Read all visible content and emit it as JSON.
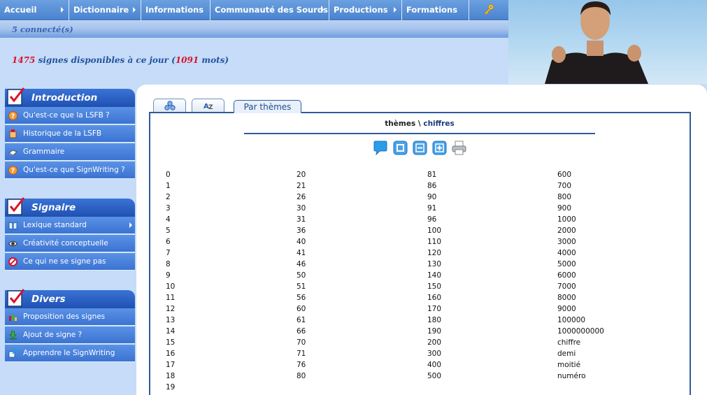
{
  "nav": {
    "items": [
      {
        "label": "Accueil",
        "has_arrow": true
      },
      {
        "label": "Dictionnaire",
        "has_arrow": true
      },
      {
        "label": "Informations",
        "has_arrow": false
      },
      {
        "label": "Communauté des Sourds",
        "has_arrow": true
      },
      {
        "label": "Productions",
        "has_arrow": true
      },
      {
        "label": "Formations",
        "has_arrow": false
      }
    ],
    "key_icon": "key-icon"
  },
  "header": {
    "connected": "5 connecté(s)",
    "signs_count": "1475",
    "signs_text": " signes disponibles à ce jour (",
    "words_count": "1091",
    "words_text": " mots)"
  },
  "sidebar": {
    "sections": [
      {
        "title": "Introduction",
        "items": [
          {
            "label": "Qu'est-ce que la LSFB ?",
            "icon": "question-icon"
          },
          {
            "label": "Historique de la LSFB",
            "icon": "history-icon"
          },
          {
            "label": "Grammaire",
            "icon": "grammar-icon"
          },
          {
            "label": "Qu'est-ce que SignWriting ?",
            "icon": "question-icon"
          }
        ]
      },
      {
        "title": "Signaire",
        "items": [
          {
            "label": "Lexique standard",
            "icon": "book-icon",
            "has_arrow": true
          },
          {
            "label": "Créativité conceptuelle",
            "icon": "eye-icon"
          },
          {
            "label": "Ce qui ne se signe pas",
            "icon": "forbidden-icon"
          }
        ]
      },
      {
        "title": "Divers",
        "items": [
          {
            "label": "Proposition des signes",
            "icon": "chart-icon"
          },
          {
            "label": "Ajout de signe ?",
            "icon": "download-icon"
          },
          {
            "label": "Apprendre le SignWriting",
            "icon": "export-icon"
          }
        ]
      }
    ]
  },
  "tabs": {
    "tab1_icon": "cluster-icon",
    "tab2_icon": "alphabet-icon",
    "active_label": "Par thèmes"
  },
  "breadcrumb": {
    "root": "thèmes",
    "separator": " \\ ",
    "current": "chiffres"
  },
  "toolbar": {
    "icons": [
      "speech-bubble-icon",
      "zoom-reset-icon",
      "zoom-out-icon",
      "zoom-in-icon",
      "printer-icon"
    ]
  },
  "words": {
    "col1": [
      "0",
      "1",
      "2",
      "3",
      "4",
      "5",
      "6",
      "7",
      "8",
      "9",
      "10",
      "11",
      "12",
      "13",
      "14",
      "15",
      "16",
      "17",
      "18",
      "19"
    ],
    "col2": [
      "20",
      "21",
      "26",
      "30",
      "31",
      "36",
      "40",
      "41",
      "46",
      "50",
      "51",
      "56",
      "60",
      "61",
      "66",
      "70",
      "71",
      "76",
      "80"
    ],
    "col3": [
      "81",
      "86",
      "90",
      "91",
      "96",
      "100",
      "110",
      "120",
      "130",
      "140",
      "150",
      "160",
      "170",
      "180",
      "190",
      "200",
      "300",
      "400",
      "500"
    ],
    "col4": [
      "600",
      "700",
      "800",
      "900",
      "1000",
      "2000",
      "3000",
      "4000",
      "5000",
      "6000",
      "7000",
      "8000",
      "9000",
      "100000",
      "1000000000",
      "chiffre",
      "demi",
      "moitié",
      "numéro"
    ]
  },
  "colors": {
    "nav_blue": "#4a83cf",
    "sidebar_blue": "#3b73d2",
    "accent_red": "#d9132b",
    "border_navy": "#2e5b9a"
  }
}
